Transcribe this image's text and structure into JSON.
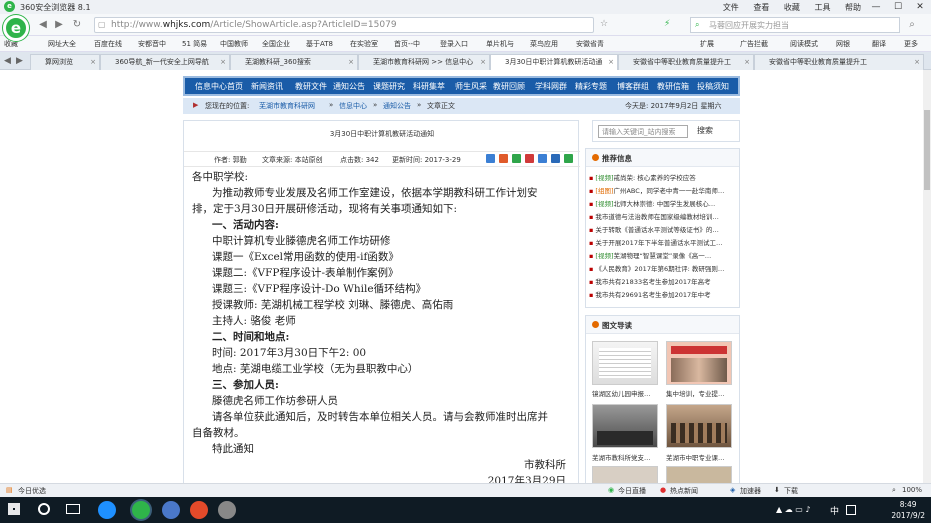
{
  "window": {
    "title": "360安全浏览器 8.1",
    "menu": [
      "文件",
      "查看",
      "收藏",
      "工具",
      "帮助"
    ],
    "controls": [
      "—",
      "☐",
      "✕"
    ]
  },
  "address": {
    "url_prefix": "http://www.",
    "url_domain": "whjks.com",
    "url_path": "/Article/ShowArticle.asp?ArticleID=15079",
    "search_placeholder": "马蓉回应开展实力担当"
  },
  "favorites": [
    "收藏",
    "网址大全",
    "百度在线",
    "安都音中",
    "51 简易",
    "中国教师",
    "全国企业",
    "基于AT8",
    "在实验室",
    "首页--中",
    "登录入口",
    "单片机与",
    "菜鸟应用",
    "安徽省青",
    "扩展",
    "广告拦截",
    "阅读模式",
    "网银",
    "翻译",
    "更多"
  ],
  "tabs": [
    {
      "label": "算网浏览",
      "active": false
    },
    {
      "label": "360导航_新一代安全上网导航",
      "active": false
    },
    {
      "label": "芜湖教科研_360搜索",
      "active": false
    },
    {
      "label": "芜湖市教育科研网 >> 信息中心",
      "active": false
    },
    {
      "label": "3月30日中职计算机教研活动通",
      "active": true
    },
    {
      "label": "安徽省中等职业教育质量提升工",
      "active": false
    },
    {
      "label": "安徽省中等职业教育质量提升工",
      "active": false
    }
  ],
  "site_nav": [
    "信息中心首页",
    "新闻资讯",
    "教研文件",
    "通知公告",
    "课题研究",
    "科研集萃",
    "师生风采",
    "教研回顾",
    "学科网群",
    "精彩专题",
    "博客群组",
    "教研信箱",
    "投稿须知"
  ],
  "crumb": {
    "prefix": "您现在的位置:",
    "items": [
      "芜湖市教育科研网",
      "信息中心",
      "通知公告",
      "文章正文"
    ],
    "date": "今天是: 2017年9月2日 星期六"
  },
  "article": {
    "title": "3月30日中职计算机教研活动通知",
    "author": "作者: 郭勤",
    "source": "文章来源: 本站原创",
    "hits": "点击数: 342",
    "updated": "更新时间: 2017-3-29",
    "lines": [
      "各中职学校:",
      "为推动教师专业发展及名师工作室建设，依据本学期教科研工作计划安",
      "排，定于3月30日开展研修活动，现将有关事项通知如下:",
      "一、活动内容:",
      "中职计算机专业滕德虎名师工作坊研修",
      "课题一《Excel常用函数的使用-if函数》",
      "课题二:《VFP程序设计-表单制作案例》",
      "课题三:《VFP程序设计-Do While循环结构》",
      "授课教师: 芜湖机械工程学校 刘琳、滕德虎、高佑雨",
      "主持人: 骆俊 老师",
      "二、时间和地点:",
      "时间: 2017年3月30日下午2: 00",
      "地点: 芜湖电缆工业学校（无为县职教中心）",
      "三、参加人员:",
      "滕德虎名师工作坊参研人员",
      "请各单位获此通知后，及时转告本单位相关人员。请与会教师准时出席并",
      "自备教材。",
      "特此通知",
      "市教科所",
      "2017年3月29日"
    ]
  },
  "side": {
    "search_placeholder": "请输入关键词_站内搜索",
    "search_button": "搜索",
    "recommend_title": "推荐信息",
    "recommend": [
      {
        "tag": "[视频]",
        "text": "戒尚荣: 核心素养的学校应答"
      },
      {
        "tag": "[组图]",
        "text": "广州ABC，同学老中青一一赴华南师…"
      },
      {
        "tag": "[视频]",
        "text": "北师大林崇德: 中国学生发展核心…"
      },
      {
        "tag": "",
        "text": "我市道德与法治教师在国家级编教材培训…"
      },
      {
        "tag": "",
        "text": "关于转歌《普通话水平测试等级证书》的…"
      },
      {
        "tag": "",
        "text": "关于开展2017年下半年普通话水平测试工…"
      },
      {
        "tag": "[视频]",
        "text": "芜湖物理“智慧课堂”录像《高一…"
      },
      {
        "tag": "",
        "text": "《人民教育》2017年第6期社评: 教研强则…"
      },
      {
        "tag": "",
        "text": "我市共有21833名考生参加2017年高考"
      },
      {
        "tag": "",
        "text": "我市共有29691名考生参加2017年中考"
      }
    ],
    "gallery_title": "图文导读",
    "gallery": [
      "镜湖区幼儿园申报…",
      "集中培训，专业提…",
      "芜湖市教科所党支…",
      "芜湖市中职专业课…"
    ]
  },
  "status": {
    "left": "今日优选",
    "items": [
      "今日直播",
      "热点新闻",
      "加速器",
      "下载",
      "100%"
    ]
  },
  "taskbar": {
    "time": "8:49",
    "date": "2017/9/2",
    "ime": "中"
  },
  "colors": {
    "nav_blue": "#1a5ca8",
    "brand_green": "#2fb44a"
  }
}
